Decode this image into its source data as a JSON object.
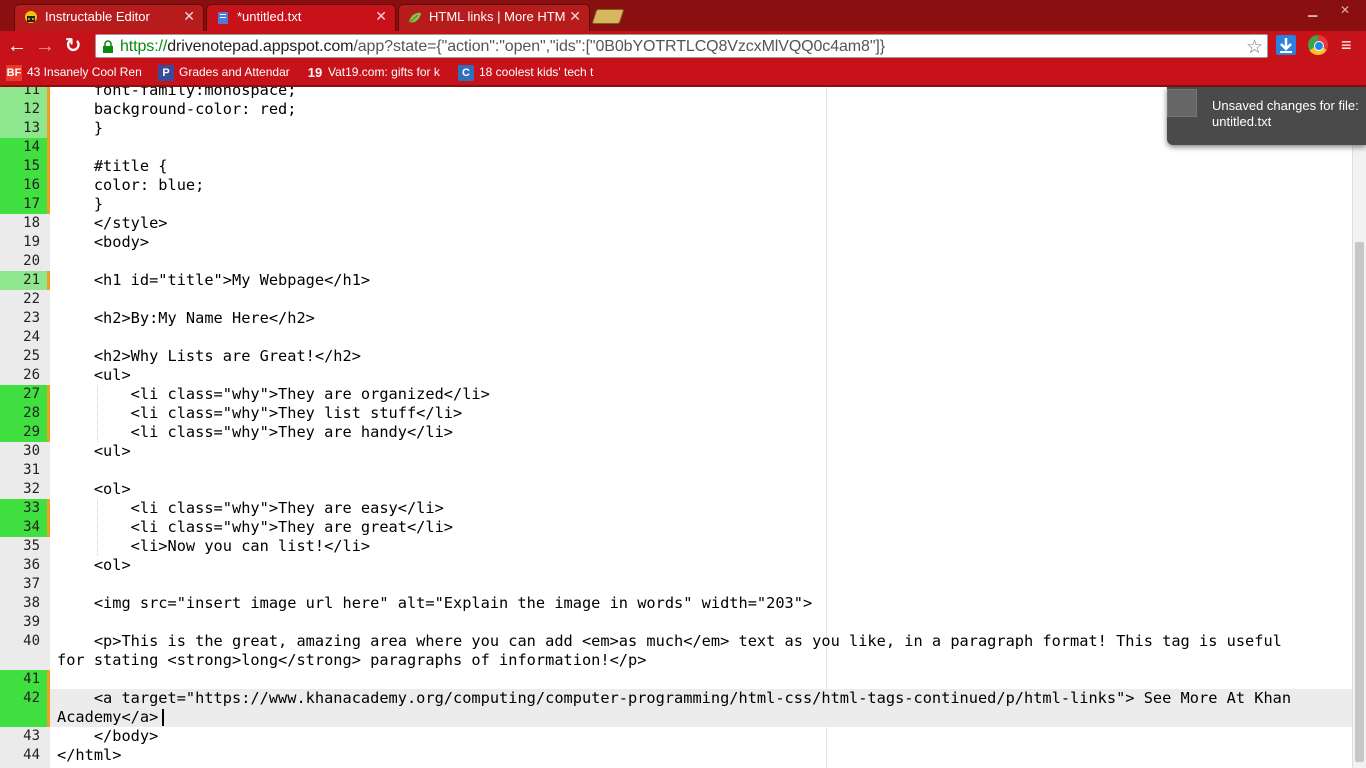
{
  "tabs": [
    {
      "title": "Instructable Editor",
      "icon": "instructables-icon",
      "active": false
    },
    {
      "title": "*untitled.txt",
      "icon": "drive-notepad-icon",
      "active": true
    },
    {
      "title": "HTML links | More HTML",
      "icon": "khan-leaf-icon",
      "active": false
    }
  ],
  "address_bar": {
    "scheme": "https://",
    "host": "drivenotepad.appspot.com",
    "path": "/app?state={\"action\":\"open\",\"ids\":[\"0B0bYOTRTLCQ8VzcxMlVQQ0c4am8\"]}"
  },
  "bookmarks": [
    {
      "label": "43 Insanely Cool Ren",
      "icon": "BF",
      "color": "#e8392b"
    },
    {
      "label": "Grades and Attendar",
      "icon": "P",
      "color": "#3a4b9c"
    },
    {
      "label": "Vat19.com: gifts for k",
      "icon": "19",
      "color": "#c8121a"
    },
    {
      "label": "18 coolest kids' tech t",
      "icon": "C",
      "color": "#2f6fbf"
    }
  ],
  "toast": {
    "message": "Unsaved changes for file: untitled.txt"
  },
  "editor": {
    "lines": [
      {
        "num": "11",
        "text": "    font-family:monospace;",
        "mark": "light"
      },
      {
        "num": "12",
        "text": "    background-color: red;",
        "mark": "light"
      },
      {
        "num": "13",
        "text": "    }",
        "mark": "light"
      },
      {
        "num": "14",
        "text": "",
        "mark": "strong"
      },
      {
        "num": "15",
        "text": "    #title {",
        "mark": "strong"
      },
      {
        "num": "16",
        "text": "    color: blue;",
        "mark": "strong"
      },
      {
        "num": "17",
        "text": "    }",
        "mark": "strong"
      },
      {
        "num": "18",
        "text": "    </style>",
        "mark": ""
      },
      {
        "num": "19",
        "text": "    <body>",
        "mark": ""
      },
      {
        "num": "20",
        "text": "",
        "mark": ""
      },
      {
        "num": "21",
        "text": "    <h1 id=\"title\">My Webpage</h1>",
        "mark": "light"
      },
      {
        "num": "22",
        "text": "",
        "mark": ""
      },
      {
        "num": "23",
        "text": "    <h2>By:My Name Here</h2>",
        "mark": ""
      },
      {
        "num": "24",
        "text": "",
        "mark": ""
      },
      {
        "num": "25",
        "text": "    <h2>Why Lists are Great!</h2>",
        "mark": ""
      },
      {
        "num": "26",
        "text": "    <ul>",
        "mark": ""
      },
      {
        "num": "27",
        "text": "        <li class=\"why\">They are organized</li>",
        "mark": "strong"
      },
      {
        "num": "28",
        "text": "        <li class=\"why\">They list stuff</li>",
        "mark": "strong"
      },
      {
        "num": "29",
        "text": "        <li class=\"why\">They are handy</li>",
        "mark": "strong"
      },
      {
        "num": "30",
        "text": "    <ul>",
        "mark": ""
      },
      {
        "num": "31",
        "text": "",
        "mark": ""
      },
      {
        "num": "32",
        "text": "    <ol>",
        "mark": ""
      },
      {
        "num": "33",
        "text": "        <li class=\"why\">They are easy</li>",
        "mark": "strong"
      },
      {
        "num": "34",
        "text": "        <li class=\"why\">They are great</li>",
        "mark": "strong"
      },
      {
        "num": "35",
        "text": "        <li>Now you can list!</li>",
        "mark": ""
      },
      {
        "num": "36",
        "text": "    <ol>",
        "mark": ""
      },
      {
        "num": "37",
        "text": "",
        "mark": ""
      },
      {
        "num": "38",
        "text": "    <img src=\"insert image url here\" alt=\"Explain the image in words\" width=\"203\">",
        "mark": ""
      },
      {
        "num": "39",
        "text": "",
        "mark": ""
      },
      {
        "num": "40",
        "text": "    <p>This is the great, amazing area where you can add <em>as much</em> text as you like, in a paragraph format! This tag is useful",
        "mark": ""
      },
      {
        "num": "",
        "text": "for stating <strong>long</strong> paragraphs of information!</p>",
        "mark": ""
      },
      {
        "num": "41",
        "text": "",
        "mark": "strong"
      },
      {
        "num": "42",
        "text": "    <a target=\"https://www.khanacademy.org/computing/computer-programming/html-css/html-tags-continued/p/html-links\"> See More At Khan",
        "mark": "strong"
      },
      {
        "num": "",
        "text": "Academy</a>",
        "mark": "strong"
      },
      {
        "num": "43",
        "text": "    </body>",
        "mark": ""
      },
      {
        "num": "44",
        "text": "</html>",
        "mark": ""
      }
    ]
  }
}
